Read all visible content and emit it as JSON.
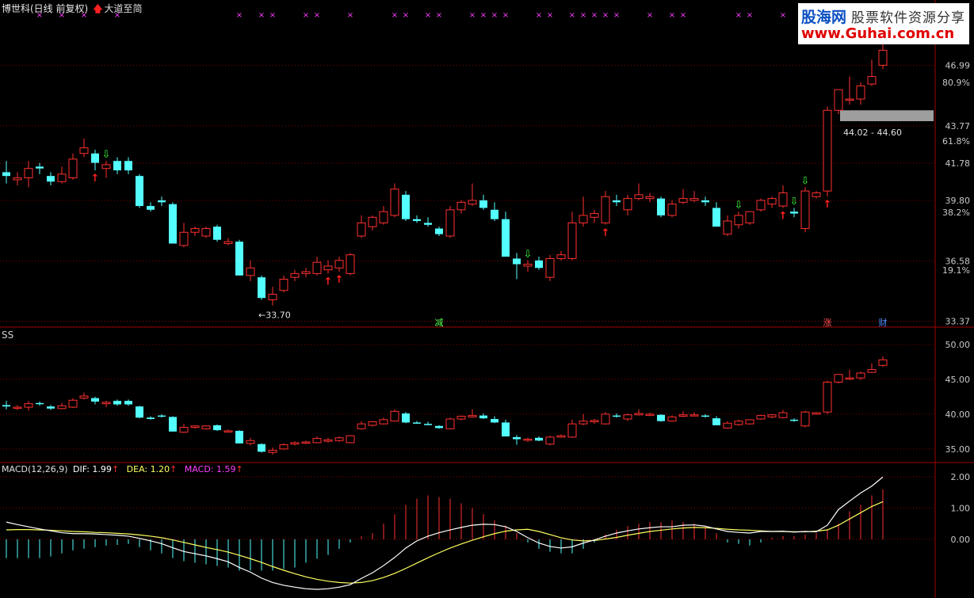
{
  "header": {
    "stock_title": "博世科(日线 前复权)",
    "indicator_name": "大道至简",
    "up_arrow": "🡅"
  },
  "watermark": {
    "brand": "股海网",
    "tagline": "股票软件资源分享",
    "url": "www.Guhai.com.cn"
  },
  "colors": {
    "up": "#ff3030",
    "down": "#54ffff",
    "grid": "#8b0000",
    "axis_text": "#c8c8c8",
    "dif": "#ffffff",
    "dea": "#ffff60",
    "macd_label": "#ff40ff",
    "marker": "#ff40ff",
    "band": "#9e9e9e"
  },
  "chart_data": [
    {
      "type": "candlestick",
      "name": "main",
      "y_ticks": [
        "46.99",
        "43.77",
        "41.78",
        "39.80",
        "36.58",
        "33.37"
      ],
      "pct_ticks": [
        "80.9%",
        "61.8%",
        "38.2%",
        "19.1%"
      ],
      "ylim": [
        33.3,
        49.0
      ],
      "low_annotation": "←33.70",
      "band_label": "44.02 - 44.60",
      "bottom_labels": [
        "减",
        "涨",
        "财"
      ],
      "candles": [
        [
          41.3,
          41.9,
          40.7,
          41.1
        ],
        [
          40.9,
          41.3,
          40.6,
          41.0
        ],
        [
          41.0,
          41.9,
          40.5,
          41.5
        ],
        [
          41.6,
          41.8,
          41.2,
          41.5
        ],
        [
          41.1,
          41.3,
          40.6,
          40.8
        ],
        [
          40.8,
          41.6,
          40.7,
          41.2
        ],
        [
          41.0,
          42.3,
          40.9,
          42.0
        ],
        [
          42.3,
          43.1,
          42.1,
          42.6
        ],
        [
          42.3,
          42.5,
          41.4,
          41.8
        ],
        [
          41.5,
          41.9,
          41.0,
          41.7
        ],
        [
          41.9,
          42.1,
          41.2,
          41.4
        ],
        [
          41.9,
          42.1,
          41.2,
          41.4
        ],
        [
          41.1,
          41.2,
          39.4,
          39.5
        ],
        [
          39.5,
          39.7,
          39.2,
          39.3
        ],
        [
          39.8,
          40.0,
          39.5,
          39.7
        ],
        [
          39.6,
          39.7,
          37.5,
          37.5
        ],
        [
          37.4,
          38.6,
          37.3,
          38.1
        ],
        [
          38.1,
          38.4,
          37.9,
          38.3
        ],
        [
          37.9,
          38.4,
          37.8,
          38.3
        ],
        [
          38.4,
          38.5,
          37.6,
          37.7
        ],
        [
          37.5,
          37.8,
          37.4,
          37.6
        ],
        [
          37.6,
          37.7,
          35.8,
          35.8
        ],
        [
          35.8,
          36.6,
          35.5,
          36.2
        ],
        [
          35.7,
          35.8,
          34.5,
          34.6
        ],
        [
          34.5,
          35.2,
          34.2,
          34.8
        ],
        [
          35.0,
          35.8,
          34.9,
          35.6
        ],
        [
          35.7,
          36.1,
          35.5,
          35.9
        ],
        [
          35.9,
          36.2,
          35.7,
          36.0
        ],
        [
          35.9,
          36.8,
          35.8,
          36.5
        ],
        [
          36.1,
          36.6,
          35.9,
          36.3
        ],
        [
          36.2,
          36.8,
          36.0,
          36.6
        ],
        [
          35.9,
          37.0,
          35.8,
          36.9
        ],
        [
          37.9,
          39.0,
          37.8,
          38.6
        ],
        [
          38.4,
          39.0,
          38.2,
          38.9
        ],
        [
          38.6,
          39.5,
          38.5,
          39.2
        ],
        [
          39.0,
          40.7,
          38.9,
          40.4
        ],
        [
          40.1,
          40.3,
          38.7,
          38.8
        ],
        [
          38.8,
          39.0,
          38.6,
          38.7
        ],
        [
          38.6,
          38.9,
          38.4,
          38.5
        ],
        [
          38.3,
          38.4,
          37.9,
          38.0
        ],
        [
          37.9,
          39.5,
          37.8,
          39.3
        ],
        [
          39.3,
          39.8,
          39.1,
          39.7
        ],
        [
          39.6,
          40.7,
          39.5,
          39.8
        ],
        [
          39.8,
          40.1,
          39.3,
          39.4
        ],
        [
          39.3,
          39.7,
          38.7,
          38.8
        ],
        [
          38.8,
          39.2,
          37.0,
          36.8
        ],
        [
          36.7,
          37.0,
          35.6,
          36.4
        ],
        [
          36.3,
          36.6,
          36.0,
          36.4
        ],
        [
          36.6,
          36.8,
          36.1,
          36.2
        ],
        [
          35.7,
          36.9,
          35.5,
          36.7
        ],
        [
          36.7,
          37.1,
          36.6,
          36.9
        ],
        [
          36.7,
          39.2,
          36.6,
          38.6
        ],
        [
          38.6,
          40.0,
          38.4,
          39.0
        ],
        [
          38.9,
          39.3,
          38.6,
          39.1
        ],
        [
          38.6,
          40.3,
          38.5,
          40.0
        ],
        [
          39.8,
          40.1,
          39.5,
          39.7
        ],
        [
          39.3,
          40.1,
          39.0,
          39.9
        ],
        [
          39.9,
          40.7,
          39.8,
          40.1
        ],
        [
          39.9,
          40.2,
          39.7,
          40.0
        ],
        [
          39.9,
          40.0,
          38.9,
          39.0
        ],
        [
          39.0,
          39.8,
          38.9,
          39.6
        ],
        [
          39.7,
          40.4,
          39.6,
          39.9
        ],
        [
          39.8,
          40.3,
          39.7,
          39.9
        ],
        [
          39.8,
          40.0,
          39.5,
          39.7
        ],
        [
          39.4,
          39.7,
          38.4,
          38.4
        ],
        [
          38.0,
          39.0,
          37.9,
          38.7
        ],
        [
          38.5,
          39.2,
          38.3,
          39.0
        ],
        [
          38.6,
          39.2,
          38.5,
          39.2
        ],
        [
          39.3,
          39.9,
          39.2,
          39.8
        ],
        [
          39.6,
          40.0,
          39.4,
          39.9
        ],
        [
          39.5,
          40.6,
          39.4,
          40.2
        ],
        [
          39.2,
          39.4,
          38.9,
          39.1
        ],
        [
          38.3,
          40.5,
          38.1,
          40.3
        ],
        [
          40.0,
          40.3,
          39.9,
          40.2
        ],
        [
          40.3,
          44.8,
          40.0,
          44.6
        ],
        [
          44.6,
          45.7,
          44.4,
          45.7
        ],
        [
          45.2,
          46.4,
          44.9,
          45.2
        ],
        [
          45.2,
          46.1,
          44.9,
          45.9
        ],
        [
          46.0,
          47.3,
          45.9,
          46.4
        ],
        [
          47.0,
          48.3,
          46.8,
          47.8
        ]
      ],
      "markers": [
        3,
        5,
        7,
        10,
        21,
        23,
        24,
        27,
        28,
        31,
        35,
        36,
        38,
        39,
        42,
        43,
        44,
        45,
        48,
        49,
        51,
        52,
        53,
        54,
        55,
        58,
        60,
        61,
        66,
        67,
        70,
        72,
        73,
        75,
        76
      ],
      "buy_signals": [
        8,
        29,
        30,
        54,
        70,
        74
      ],
      "sell_signals": [
        9,
        47,
        66,
        71,
        72
      ]
    },
    {
      "type": "candlestick",
      "name": "SS",
      "label": "SS",
      "y_ticks": [
        "50.00",
        "45.00",
        "40.00",
        "35.00"
      ],
      "ylim": [
        33.5,
        51.7
      ]
    },
    {
      "type": "macd",
      "label": "MACD(12,26,9)",
      "dif_label": "DIF: 1.99",
      "dea_label": "DEA: 1.20",
      "macd_label": "MACD: 1.59",
      "legend_arrow": "↑",
      "y_ticks": [
        "2.00",
        "1.00",
        "0.00"
      ],
      "ylim": [
        -1.8,
        2.3
      ],
      "dif": [
        0.55,
        0.47,
        0.4,
        0.33,
        0.27,
        0.21,
        0.18,
        0.18,
        0.17,
        0.15,
        0.13,
        0.1,
        0.03,
        -0.05,
        -0.14,
        -0.27,
        -0.39,
        -0.46,
        -0.53,
        -0.62,
        -0.72,
        -0.9,
        -1.05,
        -1.24,
        -1.38,
        -1.47,
        -1.53,
        -1.58,
        -1.6,
        -1.58,
        -1.53,
        -1.45,
        -1.25,
        -1.07,
        -0.84,
        -0.58,
        -0.28,
        -0.05,
        0.1,
        0.21,
        0.3,
        0.38,
        0.45,
        0.48,
        0.47,
        0.4,
        0.25,
        0.05,
        -0.12,
        -0.23,
        -0.28,
        -0.24,
        -0.12,
        -0.02,
        0.1,
        0.2,
        0.27,
        0.33,
        0.37,
        0.4,
        0.4,
        0.45,
        0.46,
        0.42,
        0.33,
        0.25,
        0.22,
        0.2,
        0.25,
        0.25,
        0.26,
        0.23,
        0.25,
        0.24,
        0.45,
        0.95,
        1.22,
        1.48,
        1.7,
        1.99
      ],
      "dea": [
        0.3,
        0.31,
        0.31,
        0.3,
        0.29,
        0.27,
        0.25,
        0.24,
        0.22,
        0.21,
        0.19,
        0.17,
        0.14,
        0.1,
        0.05,
        -0.02,
        -0.1,
        -0.18,
        -0.26,
        -0.33,
        -0.41,
        -0.51,
        -0.62,
        -0.74,
        -0.87,
        -0.99,
        -1.1,
        -1.2,
        -1.28,
        -1.34,
        -1.38,
        -1.4,
        -1.38,
        -1.32,
        -1.22,
        -1.09,
        -0.93,
        -0.76,
        -0.59,
        -0.43,
        -0.28,
        -0.15,
        -0.03,
        0.08,
        0.18,
        0.26,
        0.3,
        0.32,
        0.25,
        0.15,
        0.05,
        -0.02,
        -0.05,
        -0.04,
        0.01,
        0.06,
        0.13,
        0.19,
        0.25,
        0.29,
        0.33,
        0.36,
        0.38,
        0.37,
        0.35,
        0.32,
        0.3,
        0.29,
        0.27,
        0.25,
        0.25,
        0.24,
        0.24,
        0.26,
        0.3,
        0.45,
        0.65,
        0.85,
        1.05,
        1.2
      ],
      "hist": [
        -0.6,
        -0.6,
        -0.6,
        -0.6,
        -0.55,
        -0.45,
        -0.35,
        -0.3,
        -0.25,
        -0.2,
        -0.18,
        -0.15,
        -0.25,
        -0.35,
        -0.45,
        -0.6,
        -0.7,
        -0.75,
        -0.8,
        -0.85,
        -0.9,
        -1.0,
        -1.0,
        -1.0,
        -1.0,
        -0.95,
        -0.9,
        -0.75,
        -0.62,
        -0.5,
        -0.3,
        -0.1,
        0.1,
        0.2,
        0.5,
        0.8,
        1.1,
        1.3,
        1.4,
        1.35,
        1.3,
        1.15,
        1.0,
        0.8,
        0.6,
        0.45,
        0.2,
        -0.1,
        -0.3,
        -0.4,
        -0.45,
        -0.45,
        -0.3,
        -0.1,
        0.15,
        0.3,
        0.42,
        0.5,
        0.55,
        0.55,
        0.6,
        0.55,
        0.5,
        0.4,
        0.2,
        -0.1,
        -0.15,
        -0.2,
        -0.1,
        0.05,
        0.1,
        0.1,
        0.15,
        0.2,
        0.3,
        0.5,
        0.9,
        1.1,
        1.4,
        1.59
      ]
    }
  ]
}
